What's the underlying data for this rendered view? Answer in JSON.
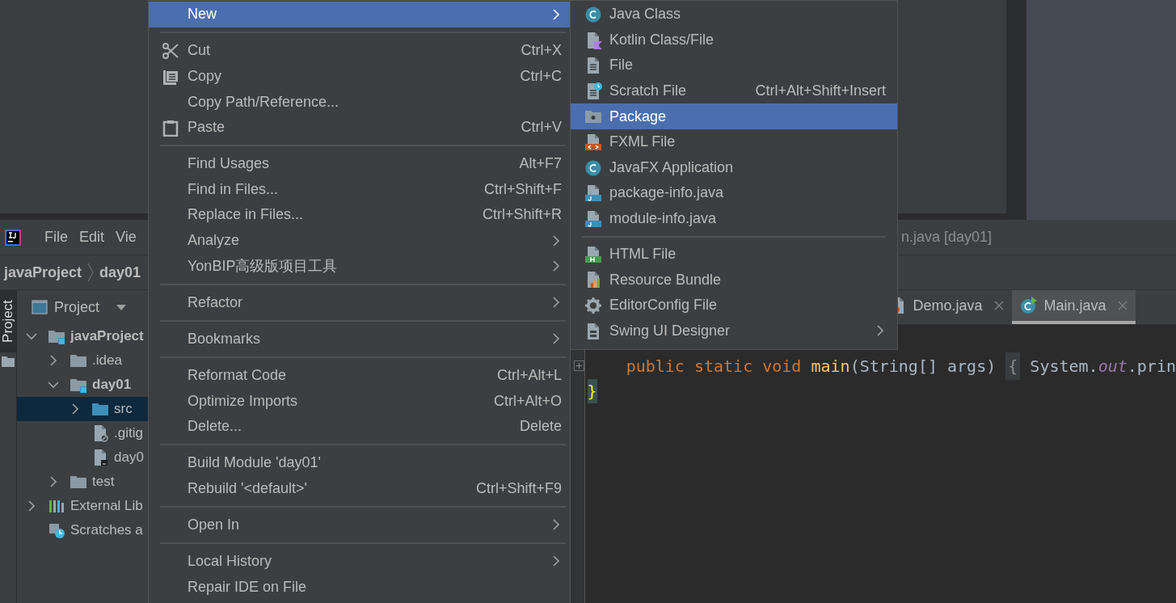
{
  "ide": {
    "menu_bar": [
      {
        "label": "File"
      },
      {
        "label": "Edit"
      },
      {
        "label": "Vie"
      }
    ],
    "title_fragment": "n.java [day01]",
    "breadcrumb": [
      "javaProject",
      "day01"
    ],
    "tool_window_tab": {
      "label": "Project",
      "selected": true
    },
    "project_panel": {
      "title": "Project",
      "tree": [
        {
          "label": "javaProject",
          "kind": "module",
          "expanded": true,
          "selected": false,
          "children": [
            {
              "label": ".idea",
              "kind": "folder",
              "expanded": false,
              "selected": false
            },
            {
              "label": "day01",
              "kind": "module",
              "expanded": true,
              "selected": false,
              "children": [
                {
                  "label": "src",
                  "kind": "source",
                  "expanded": false,
                  "selected": true
                },
                {
                  "label": ".gitig",
                  "kind": "ignorefile",
                  "selected": false
                },
                {
                  "label": "day0",
                  "kind": "modulefile",
                  "selected": false
                }
              ]
            },
            {
              "label": "test",
              "kind": "folder",
              "expanded": false,
              "selected": false
            }
          ]
        },
        {
          "label": "External Lib",
          "kind": "libraries",
          "expanded": false,
          "selected": false
        },
        {
          "label": "Scratches a",
          "kind": "scratches",
          "selected": false
        }
      ]
    },
    "editor_tabs": [
      {
        "label": "Demo.java",
        "kind": "javafile",
        "selected": false
      },
      {
        "label": "Main.java",
        "kind": "mainclass",
        "selected": true
      }
    ],
    "code_lines": [
      {
        "folded": true,
        "tokens": [
          {
            "kind": "keyword",
            "text": "    public static void "
          },
          {
            "kind": "method",
            "text": "main"
          },
          {
            "kind": "plain",
            "text": "(String[] args) "
          },
          {
            "kind": "fold",
            "text": "{"
          },
          {
            "kind": "plain",
            "text": " System."
          },
          {
            "kind": "field",
            "text": "out"
          },
          {
            "kind": "plain",
            "text": ".prin"
          }
        ]
      },
      {
        "folded": false,
        "tokens": [
          {
            "kind": "brace",
            "text": "}"
          }
        ]
      }
    ]
  },
  "context_menu": {
    "items": [
      {
        "kind": "action",
        "label": "New",
        "submenu": true,
        "selected": true
      },
      {
        "kind": "separator"
      },
      {
        "kind": "cut",
        "label": "Cut",
        "shortcut": "Ctrl+X",
        "submenu": false,
        "selected": false
      },
      {
        "kind": "copy",
        "label": "Copy",
        "shortcut": "Ctrl+C",
        "submenu": false,
        "selected": false
      },
      {
        "kind": "action",
        "label": "Copy Path/Reference...",
        "submenu": false,
        "selected": false
      },
      {
        "kind": "paste",
        "label": "Paste",
        "shortcut": "Ctrl+V",
        "submenu": false,
        "selected": false
      },
      {
        "kind": "separator"
      },
      {
        "kind": "action",
        "label": "Find Usages",
        "shortcut": "Alt+F7",
        "submenu": false,
        "selected": false
      },
      {
        "kind": "action",
        "label": "Find in Files...",
        "shortcut": "Ctrl+Shift+F",
        "submenu": false,
        "selected": false
      },
      {
        "kind": "action",
        "label": "Replace in Files...",
        "shortcut": "Ctrl+Shift+R",
        "submenu": false,
        "selected": false
      },
      {
        "kind": "action",
        "label": "Analyze",
        "submenu": true,
        "selected": false
      },
      {
        "kind": "action",
        "label": "YonBIP高级版项目工具",
        "submenu": true,
        "selected": false
      },
      {
        "kind": "separator"
      },
      {
        "kind": "action",
        "label": "Refactor",
        "submenu": true,
        "selected": false
      },
      {
        "kind": "separator"
      },
      {
        "kind": "action",
        "label": "Bookmarks",
        "submenu": true,
        "selected": false
      },
      {
        "kind": "separator"
      },
      {
        "kind": "action",
        "label": "Reformat Code",
        "shortcut": "Ctrl+Alt+L",
        "submenu": false,
        "selected": false
      },
      {
        "kind": "action",
        "label": "Optimize Imports",
        "shortcut": "Ctrl+Alt+O",
        "submenu": false,
        "selected": false
      },
      {
        "kind": "action",
        "label": "Delete...",
        "shortcut": "Delete",
        "submenu": false,
        "selected": false
      },
      {
        "kind": "separator"
      },
      {
        "kind": "action",
        "label": "Build Module 'day01'",
        "submenu": false,
        "selected": false
      },
      {
        "kind": "action",
        "label": "Rebuild '<default>'",
        "shortcut": "Ctrl+Shift+F9",
        "submenu": false,
        "selected": false
      },
      {
        "kind": "separator"
      },
      {
        "kind": "action",
        "label": "Open In",
        "submenu": true,
        "selected": false
      },
      {
        "kind": "separator"
      },
      {
        "kind": "action",
        "label": "Local History",
        "submenu": true,
        "selected": false
      },
      {
        "kind": "action",
        "label": "Repair IDE on File",
        "submenu": false,
        "selected": false
      }
    ]
  },
  "new_submenu": {
    "items": [
      {
        "kind": "class",
        "label": "Java Class",
        "submenu": false,
        "selected": false
      },
      {
        "kind": "kotlin",
        "label": "Kotlin Class/File",
        "submenu": false,
        "selected": false
      },
      {
        "kind": "file",
        "label": "File",
        "submenu": false,
        "selected": false
      },
      {
        "kind": "scratch",
        "label": "Scratch File",
        "shortcut": "Ctrl+Alt+Shift+Insert",
        "submenu": false,
        "selected": false
      },
      {
        "kind": "package",
        "label": "Package",
        "submenu": false,
        "selected": true
      },
      {
        "kind": "fxml",
        "label": "FXML File",
        "submenu": false,
        "selected": false
      },
      {
        "kind": "javafx",
        "label": "JavaFX Application",
        "submenu": false,
        "selected": false
      },
      {
        "kind": "javainfo",
        "label": "package-info.java",
        "submenu": false,
        "selected": false
      },
      {
        "kind": "javainfo",
        "label": "module-info.java",
        "submenu": false,
        "selected": false
      },
      {
        "kind": "separator"
      },
      {
        "kind": "html",
        "label": "HTML File",
        "submenu": false,
        "selected": false
      },
      {
        "kind": "bundle",
        "label": "Resource Bundle",
        "submenu": false,
        "selected": false
      },
      {
        "kind": "editorconfig",
        "label": "EditorConfig File",
        "submenu": false,
        "selected": false
      },
      {
        "kind": "swing",
        "label": "Swing UI Designer",
        "submenu": true,
        "selected": false
      }
    ]
  }
}
